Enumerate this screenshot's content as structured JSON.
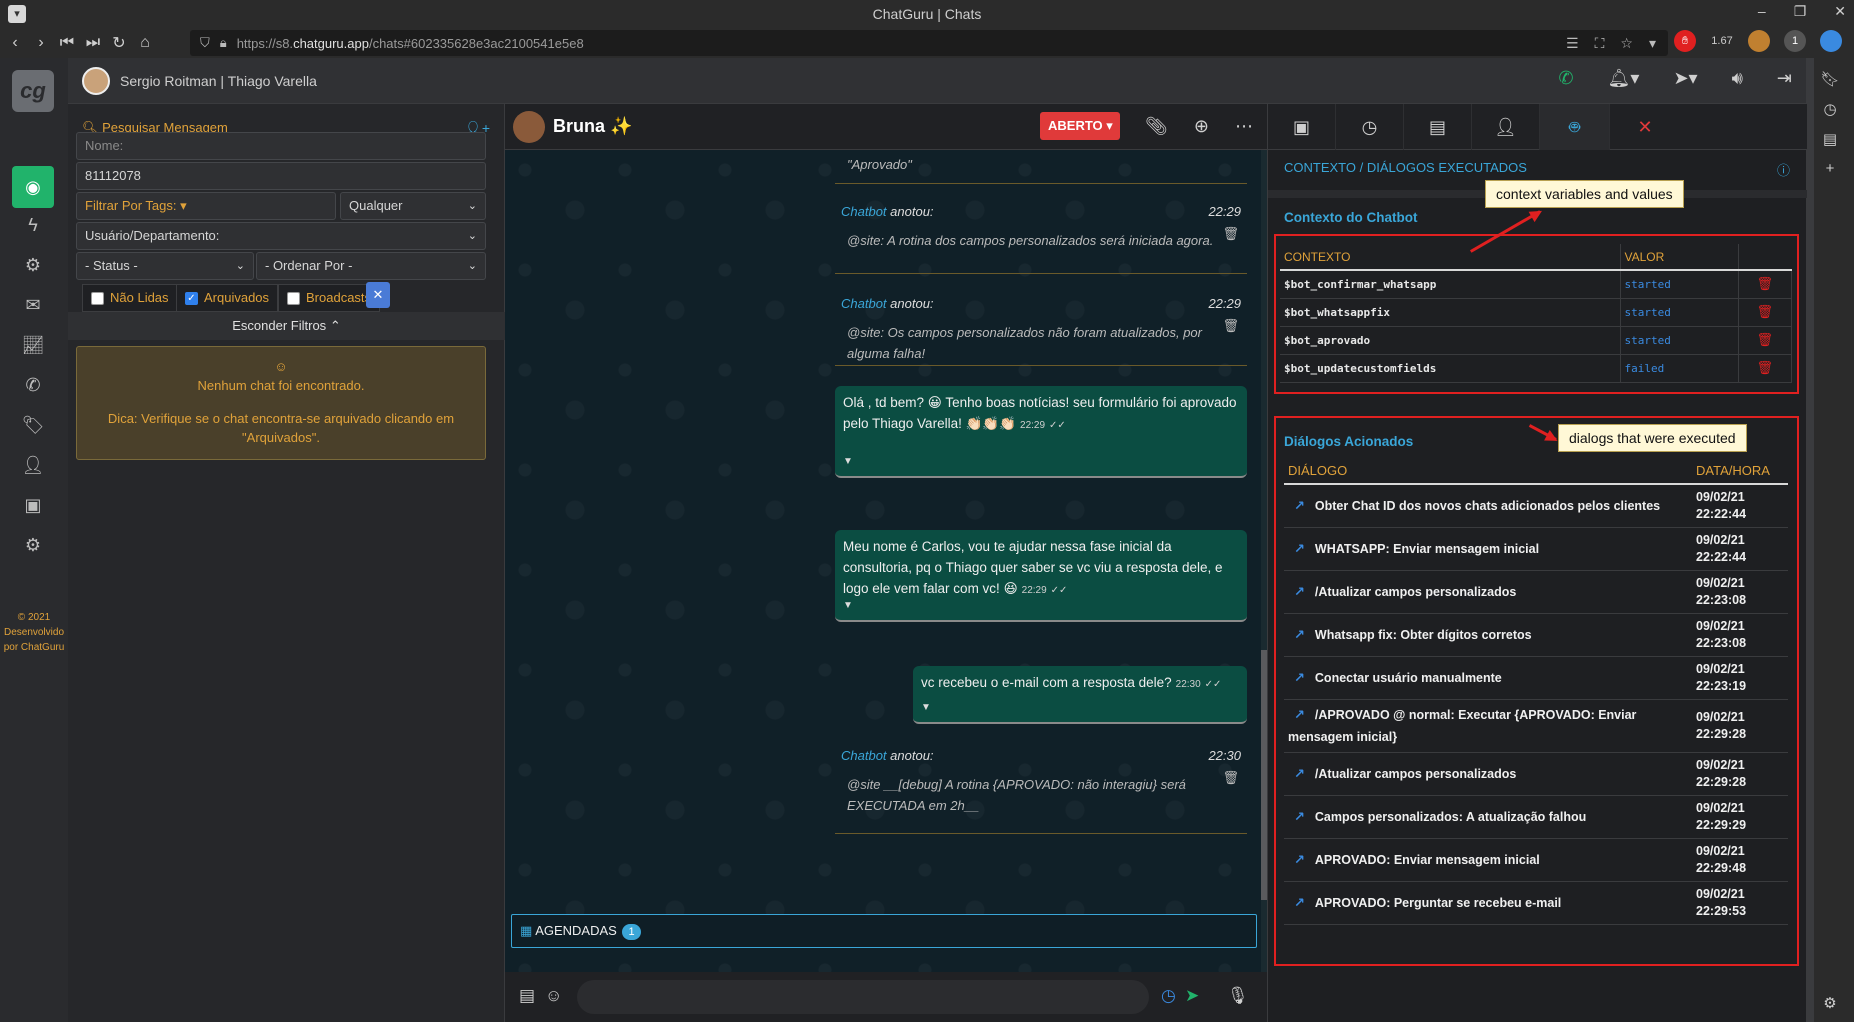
{
  "window": {
    "title": "ChatGuru | Chats"
  },
  "browser": {
    "url_prefix": "https://s8.",
    "url_domain": "chatguru.app",
    "url_path": "/chats#602335628e3ac2100541e5e8",
    "zoom": "1.67",
    "badge_count": "1"
  },
  "rail": {
    "logo": "cg",
    "copyright": "© 2021 Desenvolvido por ChatGuru"
  },
  "topbar": {
    "users": "Sergio Roitman | Thiago Varella"
  },
  "filters": {
    "search_label": "Pesquisar Mensagem",
    "name_placeholder": "Nome:",
    "phone_value": "81112078",
    "tags_label": "Filtrar Por Tags:",
    "tags_match": "Qualquer",
    "user_dept": "Usuário/Departamento:",
    "status": "- Status -",
    "order_by": "- Ordenar Por -",
    "unread_label": "Não Lidas",
    "archived_label": "Arquivados",
    "broadcasts_label": "Broadcasts",
    "hide_filters": "Esconder Filtros",
    "empty_title": "Nenhum chat foi encontrado.",
    "empty_hint": "Dica: Verifique se o chat encontra-se arquivado clicando em \"Arquivados\"."
  },
  "chat": {
    "contact_name": "Bruna ✨",
    "status": "ABERTO",
    "top_snippet": "\"Aprovado\"",
    "notes": [
      {
        "who": "Chatbot",
        "verb": "anotou:",
        "time": "22:29",
        "text": "@site: A rotina dos campos personalizados será iniciada agora."
      },
      {
        "who": "Chatbot",
        "verb": "anotou:",
        "time": "22:29",
        "text": "@site: Os campos personalizados não foram atualizados, por alguma falha!"
      },
      {
        "who": "Chatbot",
        "verb": "anotou:",
        "time": "22:30",
        "text": "@site __[debug] A rotina {APROVADO: não interagiu} será EXECUTADA em 2h__"
      }
    ],
    "messages": [
      {
        "text": "Olá , td bem? 😀 Tenho boas notícias! seu formulário foi aprovado pelo Thiago Varella! 👏🏻👏🏻👏🏻",
        "time": "22:29"
      },
      {
        "text": "Meu nome é Carlos, vou te ajudar nessa fase inicial da consultoria, pq o Thiago quer saber se vc viu a resposta dele, e logo ele vem falar com vc! 😆",
        "time": "22:29"
      },
      {
        "text": "vc recebeu o e-mail com a resposta dele?",
        "time": "22:30"
      }
    ],
    "scheduled_label": "AGENDADAS",
    "scheduled_count": "1"
  },
  "panel": {
    "title": "CONTEXTO / DIÁLOGOS EXECUTADOS",
    "context_title": "Contexto do Chatbot",
    "context_headers": {
      "var": "CONTEXTO",
      "val": "VALOR"
    },
    "context_rows": [
      {
        "var": "$bot_confirmar_whatsapp",
        "val": "started"
      },
      {
        "var": "$bot_whatsappfix",
        "val": "started"
      },
      {
        "var": "$bot_aprovado",
        "val": "started"
      },
      {
        "var": "$bot_updatecustomfields",
        "val": "failed"
      }
    ],
    "dialogs_title": "Diálogos Acionados",
    "dialogs_headers": {
      "name": "DIÁLOGO",
      "date": "DATA/HORA"
    },
    "dialogs": [
      {
        "name": "Obter Chat ID dos novos chats adicionados pelos clientes",
        "date": "09/02/21",
        "time": "22:22:44"
      },
      {
        "name": "WHATSAPP: Enviar mensagem inicial",
        "date": "09/02/21",
        "time": "22:22:44"
      },
      {
        "name": "/Atualizar campos personalizados",
        "date": "09/02/21",
        "time": "22:23:08"
      },
      {
        "name": "Whatsapp fix: Obter dígitos corretos",
        "date": "09/02/21",
        "time": "22:23:08"
      },
      {
        "name": "Conectar usuário manualmente",
        "date": "09/02/21",
        "time": "22:23:19"
      },
      {
        "name": "/APROVADO @ normal: Executar {APROVADO: Enviar mensagem inicial}",
        "date": "09/02/21",
        "time": "22:29:28"
      },
      {
        "name": "/Atualizar campos personalizados",
        "date": "09/02/21",
        "time": "22:29:28"
      },
      {
        "name": "Campos personalizados: A atualização falhou",
        "date": "09/02/21",
        "time": "22:29:29"
      },
      {
        "name": "APROVADO: Enviar mensagem inicial",
        "date": "09/02/21",
        "time": "22:29:48"
      },
      {
        "name": "APROVADO: Perguntar se recebeu e-mail",
        "date": "09/02/21",
        "time": "22:29:53"
      }
    ]
  },
  "annotations": {
    "context_callout": "context variables and values",
    "dialogs_callout": "dialogs that were executed",
    "color": "#e02020"
  }
}
